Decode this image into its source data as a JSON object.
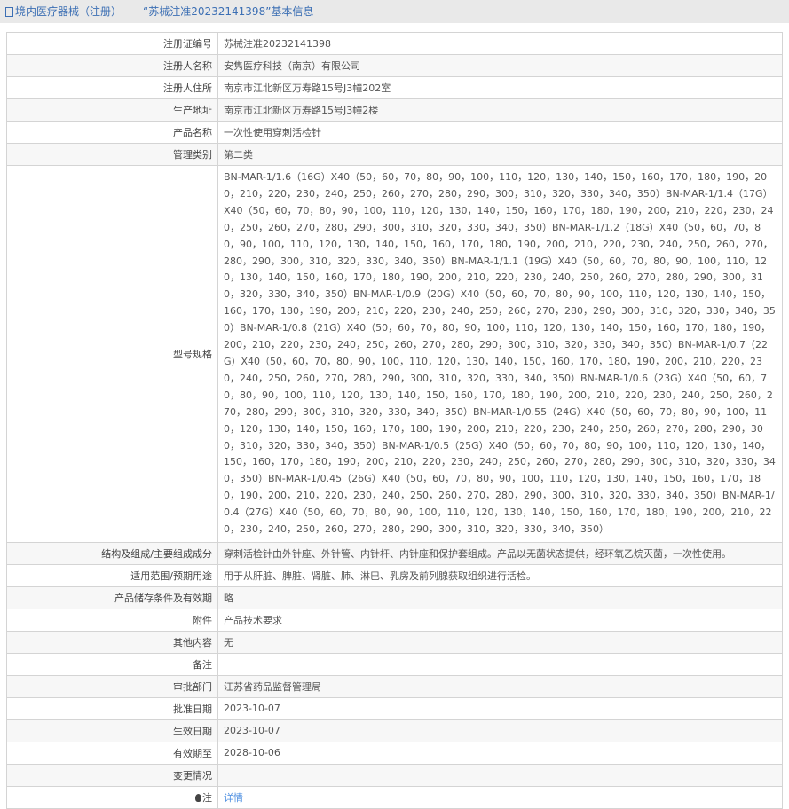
{
  "header": {
    "title": "境内医疗器械（注册）——“苏械注准20232141398”基本信息"
  },
  "rows": [
    {
      "label": "注册证编号",
      "value": "苏械注准20232141398"
    },
    {
      "label": "注册人名称",
      "value": "安隽医疗科技（南京）有限公司"
    },
    {
      "label": "注册人住所",
      "value": "南京市江北新区万寿路15号J3幢202室"
    },
    {
      "label": "生产地址",
      "value": "南京市江北新区万寿路15号J3幢2楼"
    },
    {
      "label": "产品名称",
      "value": "一次性使用穿刺活检针"
    },
    {
      "label": "管理类别",
      "value": "第二类"
    },
    {
      "label": "型号规格",
      "value": "BN-MAR-1/1.6（16G）X40（50，60，70，80，90，100，110，120，130，140，150，160，170，180，190，200，210，220，230，240，250，260，270，280，290，300，310，320，330，340，350）BN-MAR-1/1.4（17G）X40（50，60，70，80，90，100，110，120，130，140，150，160，170，180，190，200，210，220，230，240，250，260，270，280，290，300，310，320，330，340，350）BN-MAR-1/1.2（18G）X40（50，60，70，80，90，100，110，120，130，140，150，160，170，180，190，200，210，220，230，240，250，260，270，280，290，300，310，320，330，340，350）BN-MAR-1/1.1（19G）X40（50，60，70，80，90，100，110，120，130，140，150，160，170，180，190，200，210，220，230，240，250，260，270，280，290，300，310，320，330，340，350）BN-MAR-1/0.9（20G）X40（50，60，70，80，90，100，110，120，130，140，150，160，170，180，190，200，210，220，230，240，250，260，270，280，290，300，310，320，330，340，350）BN-MAR-1/0.8（21G）X40（50，60，70，80，90，100，110，120，130，140，150，160，170，180，190，200，210，220，230，240，250，260，270，280，290，300，310，320，330，340，350）BN-MAR-1/0.7（22G）X40（50，60，70，80，90，100，110，120，130，140，150，160，170，180，190，200，210，220，230，240，250，260，270，280，290，300，310，320，330，340，350）BN-MAR-1/0.6（23G）X40（50，60，70，80，90，100，110，120，130，140，150，160，170，180，190，200，210，220，230，240，250，260，270，280，290，300，310，320，330，340，350）BN-MAR-1/0.55（24G）X40（50，60，70，80，90，100，110，120，130，140，150，160，170，180，190，200，210，220，230，240，250，260，270，280，290，300，310，320，330，340，350）BN-MAR-1/0.5（25G）X40（50，60，70，80，90，100，110，120，130，140，150，160，170，180，190，200，210，220，230，240，250，260，270，280，290，300，310，320，330，340，350）BN-MAR-1/0.45（26G）X40（50，60，70，80，90，100，110，120，130，140，150，160，170，180，190，200，210，220，230，240，250，260，270，280，290，300，310，320，330，340，350）BN-MAR-1/0.4（27G）X40（50，60，70，80，90，100，110，120，130，140，150，160，170，180，190，200，210，220，230，240，250，260，270，280，290，300，310，320，330，340，350）"
    },
    {
      "label": "结构及组成/主要组成成分",
      "value": "穿刺活检针由外针座、外针管、内针杆、内针座和保护套组成。产品以无菌状态提供，经环氧乙烷灭菌，一次性使用。"
    },
    {
      "label": "适用范围/预期用途",
      "value": "用于从肝脏、脾脏、肾脏、肺、淋巴、乳房及前列腺获取组织进行活检。"
    },
    {
      "label": "产品储存条件及有效期",
      "value": "略"
    },
    {
      "label": "附件",
      "value": "产品技术要求"
    },
    {
      "label": "其他内容",
      "value": "无"
    },
    {
      "label": "备注",
      "value": ""
    },
    {
      "label": "审批部门",
      "value": "江苏省药品监督管理局"
    },
    {
      "label": "批准日期",
      "value": "2023-10-07"
    },
    {
      "label": "生效日期",
      "value": "2023-10-07"
    },
    {
      "label": "有效期至",
      "value": "2028-10-06"
    },
    {
      "label": "变更情况",
      "value": ""
    }
  ],
  "note": {
    "label": "注",
    "link": "详情"
  }
}
